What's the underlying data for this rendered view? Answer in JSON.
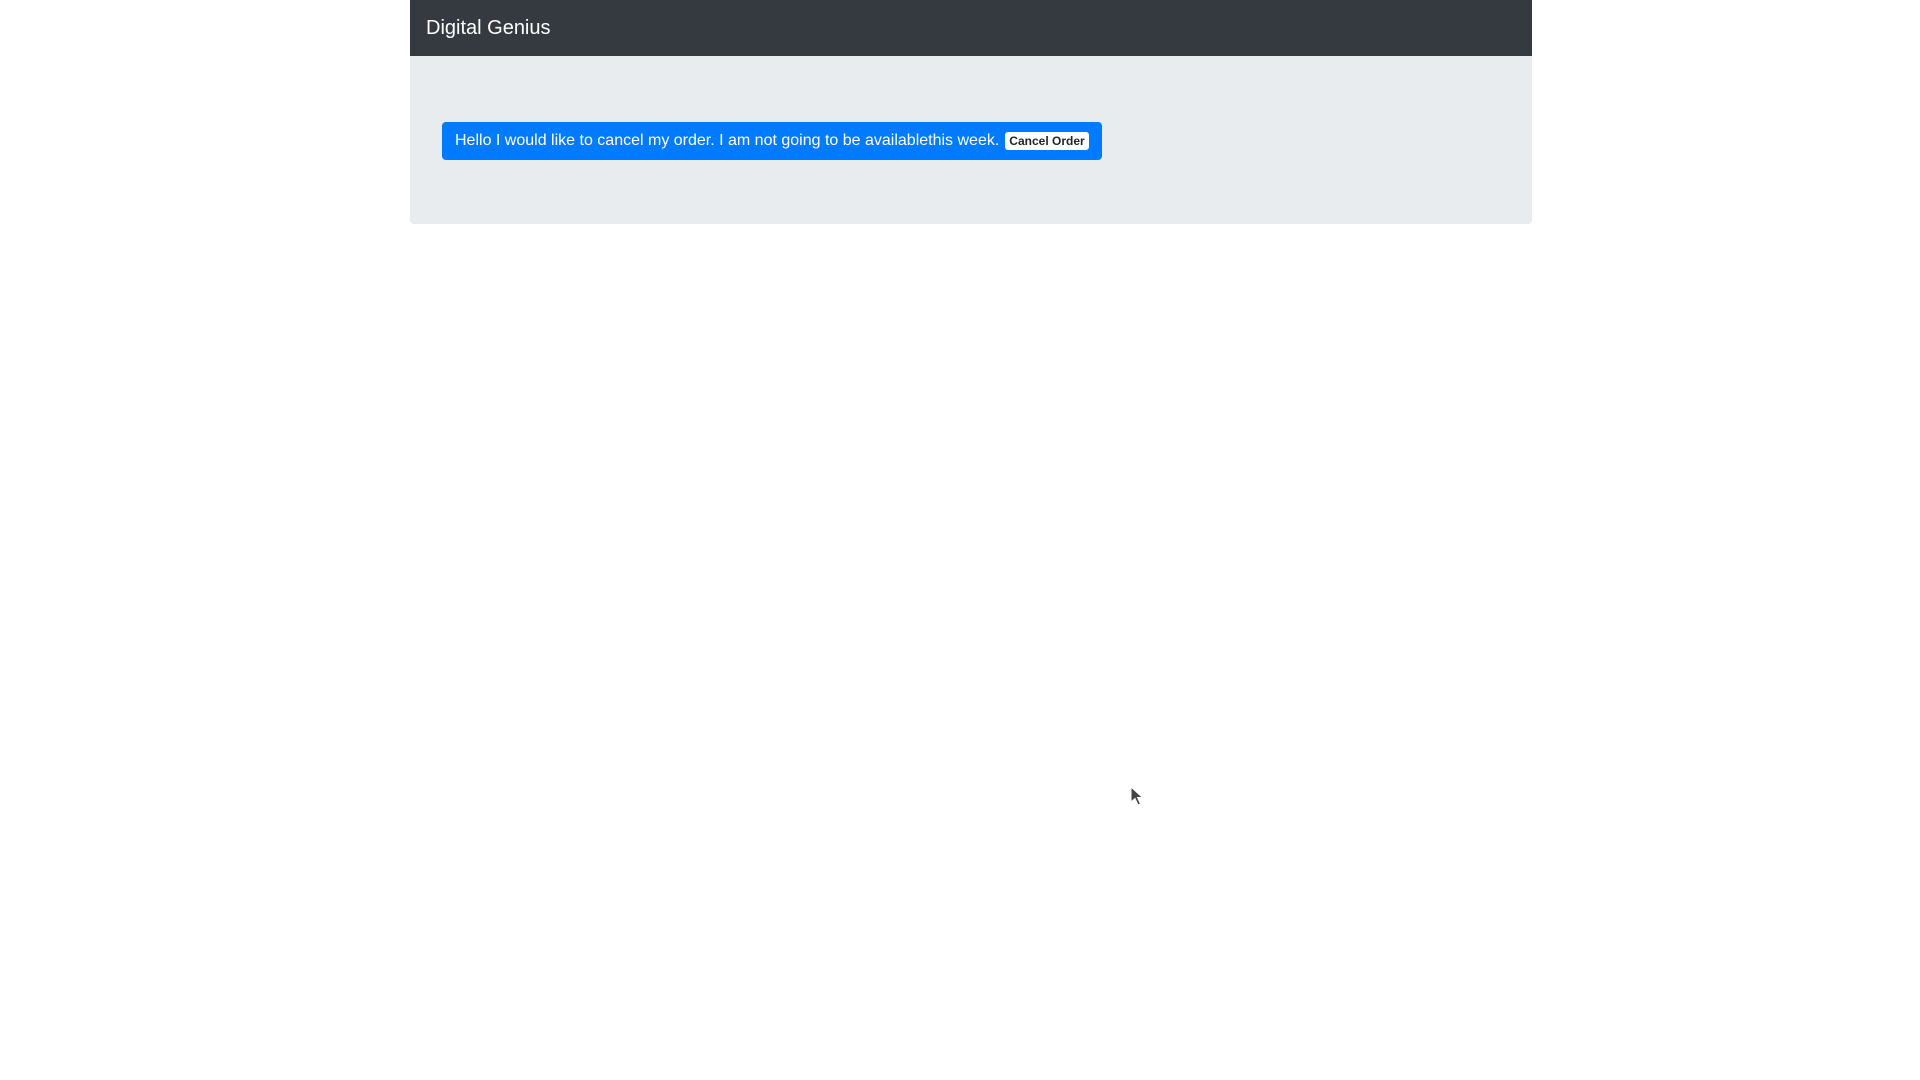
{
  "navbar": {
    "brand": "Digital Genius"
  },
  "message": {
    "text": "Hello I would like to cancel my order. I am not going to be availablethis week.",
    "action_label": "Cancel Order"
  },
  "colors": {
    "navbar_bg": "#343a40",
    "panel_bg": "#e9ecef",
    "alert_bg": "#007bff",
    "cursor": "#444444"
  },
  "icons": {
    "cursor": "mouse-pointer-icon"
  }
}
